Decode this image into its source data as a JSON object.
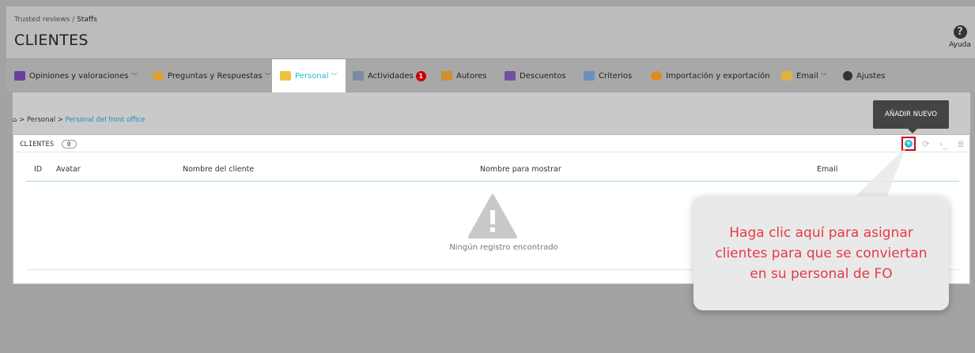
{
  "header": {
    "breadcrumb_root": "Trusted reviews",
    "breadcrumb_sep": "/",
    "breadcrumb_current": "Staffs",
    "title": "CLIENTES",
    "help_icon": "question-circle-icon",
    "help_label": "Ayuda"
  },
  "tabs": [
    {
      "label": "Opiniones y valoraciones",
      "icon": "reviews-icon",
      "has_dropdown": true
    },
    {
      "label": "Preguntas y Respuestas",
      "icon": "qa-icon",
      "has_dropdown": true
    },
    {
      "label": "Personal",
      "icon": "staff-icon",
      "has_dropdown": true,
      "active": true
    },
    {
      "label": "Actividades",
      "icon": "activity-icon",
      "badge": "1"
    },
    {
      "label": "Autores",
      "icon": "authors-icon"
    },
    {
      "label": "Descuentos",
      "icon": "discount-icon"
    },
    {
      "label": "Criterios",
      "icon": "criteria-icon"
    },
    {
      "label": "Importación y exportación",
      "icon": "import-export-icon"
    },
    {
      "label": "Email",
      "icon": "email-icon",
      "has_dropdown": true
    },
    {
      "label": "Ajustes",
      "icon": "settings-icon"
    }
  ],
  "subnav": {
    "home_icon": "home-icon",
    "sep": ">",
    "item1": "Personal",
    "item2": "Personal del front office"
  },
  "list": {
    "title": "CLIENTES",
    "count": "0",
    "columns": [
      "ID",
      "Avatar",
      "Nombre del cliente",
      "Nombre para mostrar",
      "Email"
    ],
    "empty_text": "Ningún registro encontrado",
    "tooltip": "AÑADIR NUEVO",
    "toolbar_icons": [
      "add-icon",
      "refresh-icon",
      "sql-icon",
      "database-icon"
    ]
  },
  "callout": {
    "text": "Haga clic aquí para asignar clientes para que se conviertan en su personal de FO"
  },
  "colors": {
    "accent": "#25b9d7",
    "highlight": "#d0021b",
    "callout_text": "#e63946"
  }
}
